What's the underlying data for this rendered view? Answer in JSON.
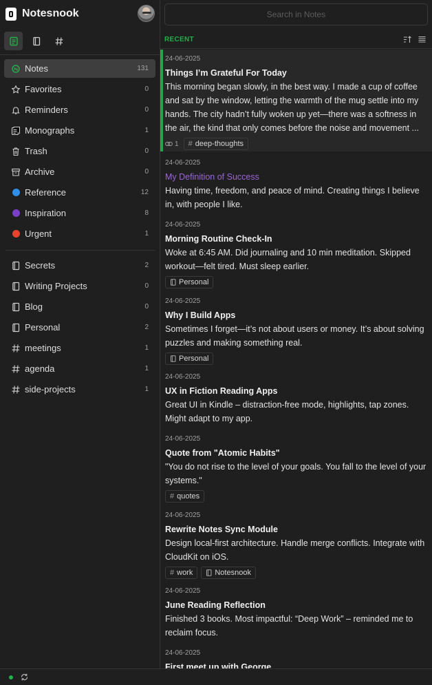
{
  "app": {
    "name": "Notesnook"
  },
  "sidebar_tabs": [
    {
      "icon": "notes-icon",
      "active": true
    },
    {
      "icon": "notebook-icon",
      "active": false
    },
    {
      "icon": "hashtag-icon",
      "active": false
    }
  ],
  "nav": [
    {
      "label": "Notes",
      "count": "131",
      "icon": "notes-icon",
      "active": true
    },
    {
      "label": "Favorites",
      "count": "0",
      "icon": "star-icon"
    },
    {
      "label": "Reminders",
      "count": "0",
      "icon": "bell-icon"
    },
    {
      "label": "Monographs",
      "count": "1",
      "icon": "monograph-icon"
    },
    {
      "label": "Trash",
      "count": "0",
      "icon": "trash-icon"
    },
    {
      "label": "Archive",
      "count": "0",
      "icon": "archive-icon"
    },
    {
      "label": "Reference",
      "count": "12",
      "icon": "color-dot",
      "color": "#2f8fe8"
    },
    {
      "label": "Inspiration",
      "count": "8",
      "icon": "color-dot",
      "color": "#7a3fc9"
    },
    {
      "label": "Urgent",
      "count": "1",
      "icon": "color-dot",
      "color": "#e8432f"
    }
  ],
  "shortcuts": [
    {
      "label": "Secrets",
      "count": "2",
      "icon": "notebook-icon"
    },
    {
      "label": "Writing Projects",
      "count": "0",
      "icon": "notebook-icon"
    },
    {
      "label": "Blog",
      "count": "0",
      "icon": "notebook-icon"
    },
    {
      "label": "Personal",
      "count": "2",
      "icon": "notebook-icon"
    },
    {
      "label": "meetings",
      "count": "1",
      "icon": "hashtag-icon"
    },
    {
      "label": "agenda",
      "count": "1",
      "icon": "hashtag-icon"
    },
    {
      "label": "side-projects",
      "count": "1",
      "icon": "hashtag-icon"
    }
  ],
  "search": {
    "placeholder": "Search in Notes"
  },
  "list": {
    "title": "RECENT"
  },
  "notes": [
    {
      "date": "24-06-2025",
      "title": "Things I’m Grateful For Today",
      "body": "This morning began slowly, in the best way. I made a cup of coffee and sat by the window, letting the warmth of the mug settle into my hands. The city hadn’t fully woken up yet—there was a softness in the air, the kind that only comes before the noise and movement ...",
      "references": "1",
      "tags": [
        "deep-thoughts"
      ],
      "notebooks": [],
      "selected": true
    },
    {
      "date": "24-06-2025",
      "title": "My Definition of Success",
      "title_color": "purple",
      "body": "Having time, freedom, and peace of mind. Creating things I believe in, with people I like.",
      "tags": [],
      "notebooks": []
    },
    {
      "date": "24-06-2025",
      "title": "Morning Routine Check-In",
      "body": "Woke at 6:45 AM. Did journaling and 10 min meditation. Skipped workout—felt tired. Must sleep earlier.",
      "tags": [],
      "notebooks": [
        "Personal"
      ]
    },
    {
      "date": "24-06-2025",
      "title": "Why I Build Apps",
      "body": "Sometimes I forget—it’s not about users or money. It’s about solving puzzles and making something real.",
      "tags": [],
      "notebooks": [
        "Personal"
      ]
    },
    {
      "date": "24-06-2025",
      "title": "UX in Fiction Reading Apps",
      "body": "Great UI in Kindle – distraction-free mode, highlights, tap zones. Might adapt to my app.",
      "tags": [],
      "notebooks": []
    },
    {
      "date": "24-06-2025",
      "title": "Quote from \"Atomic Habits\"",
      "body": "\"You do not rise to the level of your goals. You fall to the level of your systems.\"",
      "tags": [
        "quotes"
      ],
      "notebooks": []
    },
    {
      "date": "24-06-2025",
      "title": "Rewrite Notes Sync Module",
      "body": "Design local-first architecture. Handle merge conflicts. Integrate with CloudKit on iOS.",
      "tags": [
        "work"
      ],
      "notebooks": [
        "Notesnook"
      ]
    },
    {
      "date": "24-06-2025",
      "title": "June Reading Reflection",
      "body": "Finished 3 books. Most impactful: “Deep Work” – reminded me to reclaim focus.",
      "tags": [],
      "notebooks": []
    },
    {
      "date": "24-06-2025",
      "title": "First meet up with George",
      "body": "",
      "tags": [],
      "notebooks": []
    }
  ],
  "status": {
    "sync_color": "#22b04a"
  }
}
